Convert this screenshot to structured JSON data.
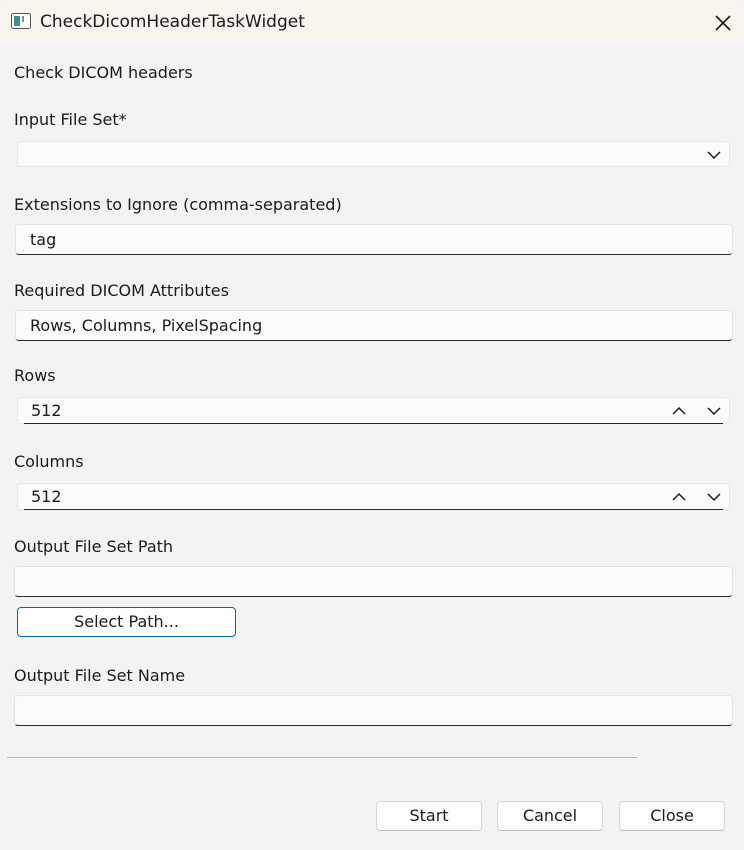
{
  "window": {
    "title": "CheckDicomHeaderTaskWidget",
    "app_icon": "window-app-icon",
    "close_icon": "close-icon"
  },
  "header": {
    "text": "Check DICOM headers"
  },
  "input_file_set": {
    "label": "Input File Set*",
    "value": "",
    "icon": "chevron-down-icon"
  },
  "extensions_to_ignore": {
    "label": "Extensions to Ignore (comma-separated)",
    "value": "tag"
  },
  "required_attributes": {
    "label": "Required DICOM Attributes",
    "value": "Rows, Columns, PixelSpacing"
  },
  "rows": {
    "label": "Rows",
    "value": "512"
  },
  "columns": {
    "label": "Columns",
    "value": "512"
  },
  "output_path": {
    "label": "Output File Set Path",
    "value": "",
    "button_label": "Select Path..."
  },
  "output_name": {
    "label": "Output File Set Name",
    "value": ""
  },
  "footer": {
    "start_label": "Start",
    "cancel_label": "Cancel",
    "close_label": "Close"
  },
  "colors": {
    "titlebar": "#f8f4ee",
    "background": "#f3f3f3",
    "accent": "#0067c0"
  }
}
